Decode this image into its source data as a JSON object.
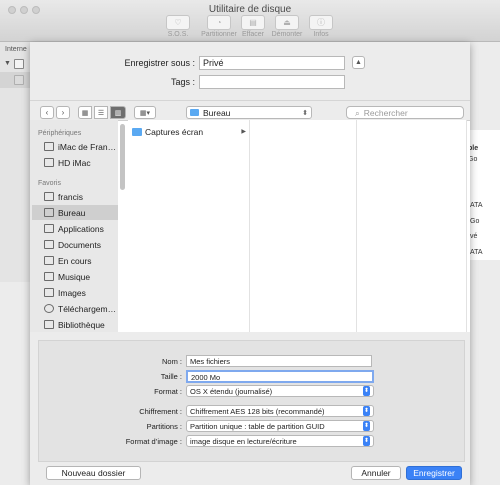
{
  "background_window": {
    "title": "Utilitaire de disque",
    "toolbar": [
      {
        "label": "S.O.S.",
        "icon": "stethoscope-icon"
      },
      {
        "label": "Partitionner",
        "icon": "pie-icon"
      },
      {
        "label": "Effacer",
        "icon": "erase-icon"
      },
      {
        "label": "Démonter",
        "icon": "eject-icon"
      },
      {
        "label": "Infos",
        "icon": "info-icon"
      }
    ],
    "sidebar_label": "Interne",
    "right_fragments": [
      "ble",
      "Go",
      "ATA",
      "Go",
      "vé",
      "ATA"
    ]
  },
  "save_sheet": {
    "save_as_label": "Enregistrer sous :",
    "save_as_value": "Privé",
    "tags_label": "Tags :",
    "location": "Bureau",
    "search_placeholder": "Rechercher",
    "sidebar": {
      "devices_header": "Périphériques",
      "devices": [
        {
          "label": "iMac de Fran…",
          "icon": "imac-icon"
        },
        {
          "label": "HD iMac",
          "icon": "hard-drive-icon"
        }
      ],
      "favorites_header": "Favoris",
      "favorites": [
        {
          "label": "francis",
          "icon": "home-icon",
          "selected": false
        },
        {
          "label": "Bureau",
          "icon": "desktop-icon",
          "selected": true
        },
        {
          "label": "Applications",
          "icon": "applications-icon",
          "selected": false
        },
        {
          "label": "Documents",
          "icon": "documents-icon",
          "selected": false
        },
        {
          "label": "En cours",
          "icon": "folder-icon",
          "selected": false
        },
        {
          "label": "Musique",
          "icon": "music-icon",
          "selected": false
        },
        {
          "label": "Images",
          "icon": "images-icon",
          "selected": false
        },
        {
          "label": "Téléchargem…",
          "icon": "downloads-icon",
          "selected": false
        },
        {
          "label": "Bibliothèque",
          "icon": "library-icon",
          "selected": false
        }
      ]
    },
    "column1": [
      "Captures écran"
    ],
    "form": {
      "name_label": "Nom :",
      "name_value": "Mes fichiers",
      "size_label": "Taille :",
      "size_value": "2000 Mo",
      "format_label": "Format :",
      "format_value": "OS X étendu (journalisé)",
      "encryption_label": "Chiffrement :",
      "encryption_value": "Chiffrement AES 128 bits (recommandé)",
      "partitions_label": "Partitions :",
      "partitions_value": "Partition unique : table de partition GUID",
      "image_format_label": "Format d’image :",
      "image_format_value": "image disque en lecture/écriture"
    },
    "buttons": {
      "new_folder": "Nouveau dossier",
      "cancel": "Annuler",
      "save": "Enregistrer"
    },
    "accent_color": "#3b82f6"
  }
}
